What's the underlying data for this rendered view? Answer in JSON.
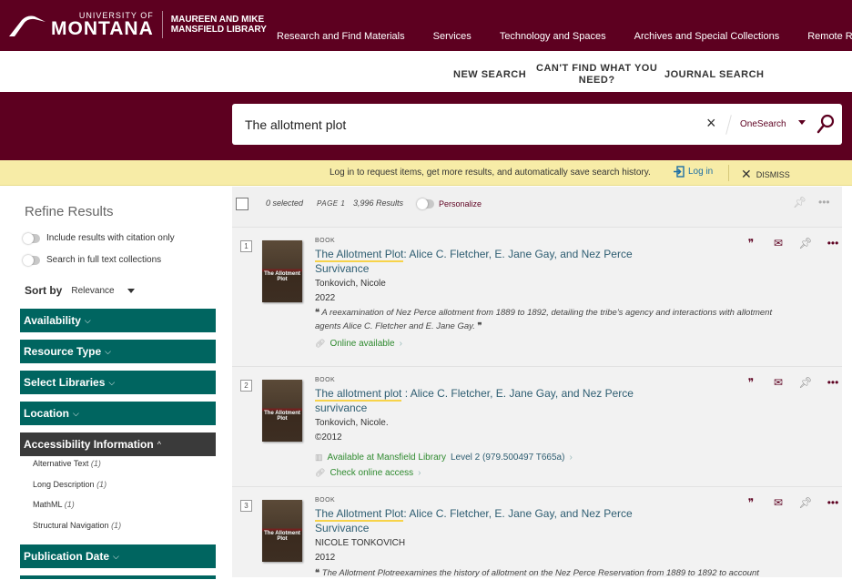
{
  "header": {
    "logo": {
      "university_of": "UNIVERSITY OF",
      "montana": "MONTANA",
      "library_line1": "MAUREEN AND MIKE",
      "library_line2": "MANSFIELD LIBRARY"
    },
    "main_nav": [
      "Research and Find Materials",
      "Services",
      "Technology and Spaces",
      "Archives and Special Collections",
      "Remote Research"
    ],
    "sub_nav": {
      "new_search": "NEW SEARCH",
      "cant_find_line1": "CAN'T FIND WHAT YOU",
      "cant_find_line2": "NEED?",
      "journal_search": "JOURNAL SEARCH"
    }
  },
  "search": {
    "query": "The allotment plot",
    "clear_icon": "×",
    "scope": "OneSearch"
  },
  "banner": {
    "message": "Log in to request items, get more results, and automatically save search history.",
    "login": "Log in",
    "dismiss": "DISMISS"
  },
  "sidebar": {
    "title": "Refine Results",
    "toggles": [
      {
        "label": "Include results with citation only",
        "on": false
      },
      {
        "label": "Search in full text collections",
        "on": false
      }
    ],
    "sort_label": "Sort by",
    "sort_value": "Relevance",
    "facets": [
      {
        "label": "Availability",
        "expanded": false
      },
      {
        "label": "Resource Type",
        "expanded": false
      },
      {
        "label": "Select Libraries",
        "expanded": false
      },
      {
        "label": "Location",
        "expanded": false
      },
      {
        "label": "Accessibility Information",
        "expanded": true
      },
      {
        "label": "Publication Date",
        "expanded": false
      }
    ],
    "accessibility_items": [
      {
        "label": "Alternative Text",
        "count": "(1)"
      },
      {
        "label": "Long Description",
        "count": "(1)"
      },
      {
        "label": "MathML",
        "count": "(1)"
      },
      {
        "label": "Structural Navigation",
        "count": "(1)"
      }
    ]
  },
  "results_bar": {
    "selected": "0 selected",
    "page": "PAGE 1",
    "count": "3,996 Results",
    "personalize": "Personalize"
  },
  "results": [
    {
      "num": "1",
      "type": "BOOK",
      "title_highlight": "The Allotment Plot",
      "title_rest": ": Alice C. Fletcher, E. Jane Gay, and Nez Perce Survivance",
      "author": "Tonkovich, Nicole",
      "date": "2022",
      "abstract": "A reexamination of Nez Perce allotment from 1889 to 1892, detailing the tribe's agency and interactions with allotment agents Alice C. Fletcher and E. Jane Gay.",
      "availability": "Online available",
      "cover_title": "The Allotment Plot"
    },
    {
      "num": "2",
      "type": "BOOK",
      "title_highlight": "The allotment plot",
      "title_rest": " : Alice C. Fletcher, E. Jane Gay, and Nez Perce survivance",
      "author": "Tonkovich, Nicole.",
      "date": "©2012",
      "availability": "Available at Mansfield Library",
      "location": "Level 2 (979.500497 T665a)",
      "availability2": "Check online access",
      "cover_title": "The Allotment Plot"
    },
    {
      "num": "3",
      "type": "BOOK",
      "title_highlight": "The Allotment Plot",
      "title_rest": ": Alice C. Fletcher, E. Jane Gay, and Nez Perce Survivance",
      "author": "NICOLE TONKOVICH",
      "date": "2012",
      "abstract": "The Allotment Plotreexamines the history of allotment on the Nez Perce Reservation from 1889 to 1892 to account",
      "cover_title": "The Allotment Plot"
    }
  ],
  "colors": {
    "brand_maroon": "#5d0020",
    "facet_teal": "#006560",
    "banner_yellow": "#f7eca7",
    "link_blue": "#2f5e72",
    "available_green": "#2f8a2f"
  }
}
